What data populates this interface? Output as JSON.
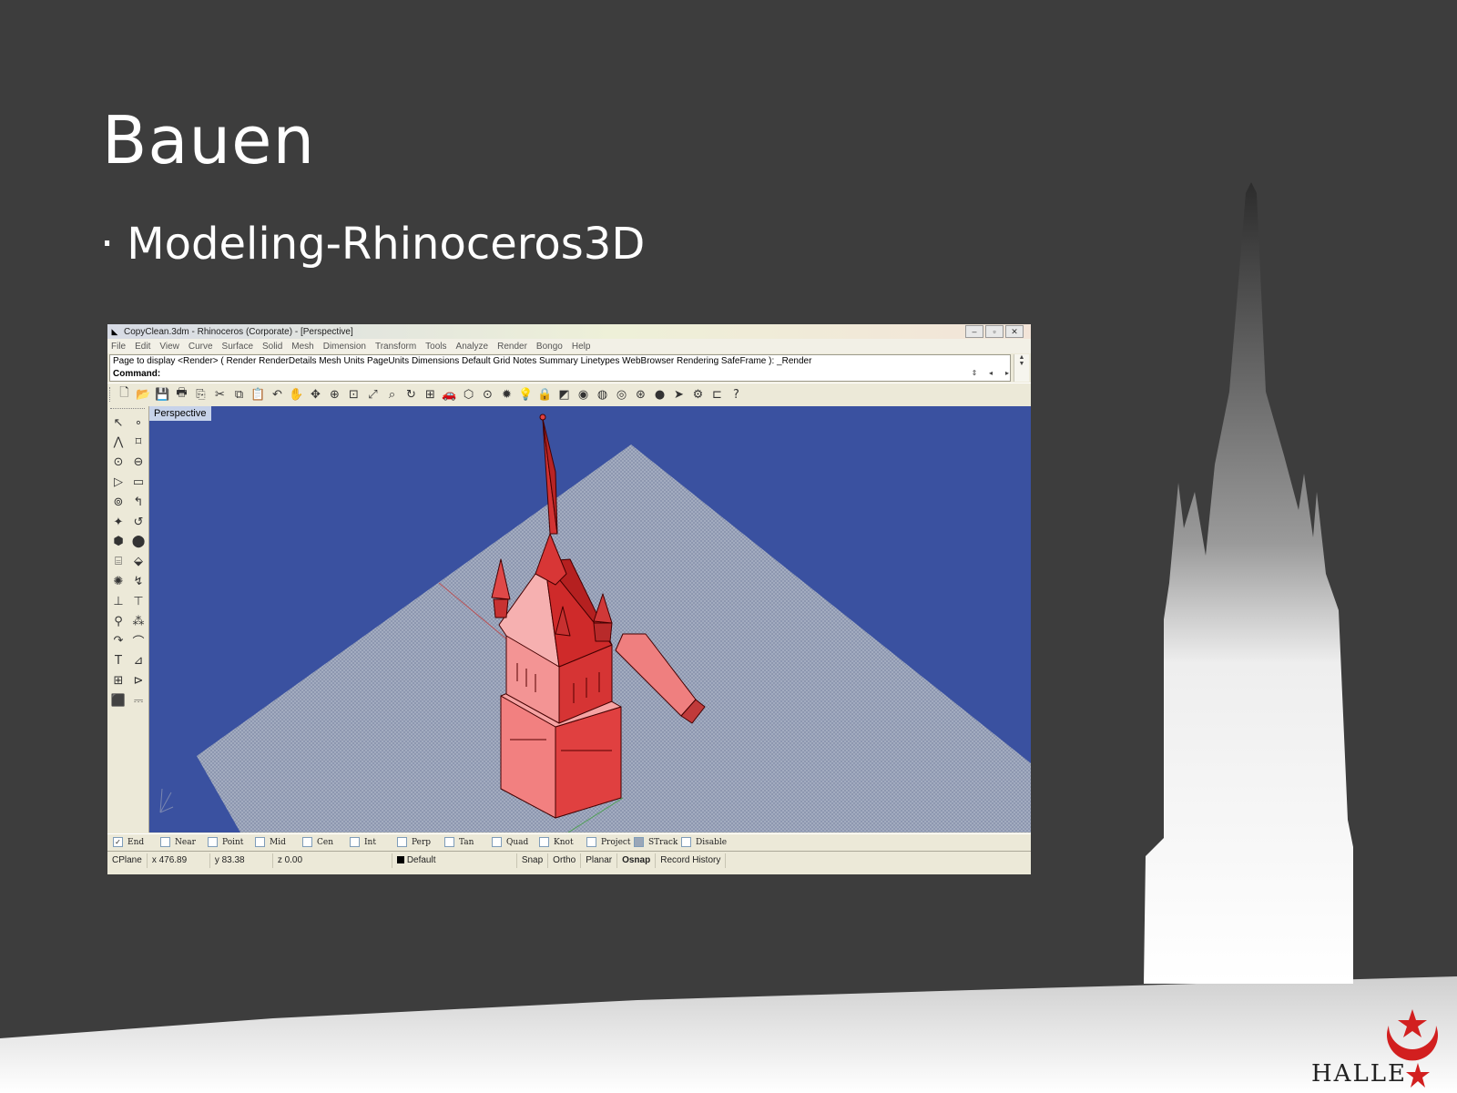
{
  "slide": {
    "title": "Bauen",
    "bullet_marker": "·",
    "bullet": "Modeling-Rhinoceros3D"
  },
  "rhino": {
    "window_title": "CopyClean.3dm - Rhinoceros (Corporate) - [Perspective]",
    "window_buttons": [
      "–",
      "▫",
      "✕"
    ],
    "menu": [
      "File",
      "Edit",
      "View",
      "Curve",
      "Surface",
      "Solid",
      "Mesh",
      "Dimension",
      "Transform",
      "Tools",
      "Analyze",
      "Render",
      "Bongo",
      "Help"
    ],
    "command_history": "Page to display <Render> ( Render  RenderDetails  Mesh  Units  PageUnits  Dimensions  Default  Grid  Notes  Summary  Linetypes  WebBrowser  Rendering  SafeFrame ): _Render",
    "command_label": "Command:",
    "toolbar_icons": [
      "new-file",
      "open-file",
      "save",
      "print",
      "import",
      "cut",
      "copy",
      "paste",
      "undo",
      "pan-hand",
      "move",
      "zoom-in",
      "zoom-window",
      "zoom-extents",
      "zoom-selected",
      "rotate-view",
      "four-viewports",
      "car-tool",
      "render-mesh",
      "point-tool",
      "snapshot-tool",
      "light-bulb",
      "lock",
      "materials",
      "color-wheel",
      "render-sphere",
      "grid-sphere",
      "render-preview",
      "shaded-sphere",
      "flag",
      "settings-gear",
      "layout-tool",
      "help"
    ],
    "viewport_label": "Perspective",
    "osnap": [
      {
        "label": "End",
        "checked": true
      },
      {
        "label": "Near",
        "checked": false
      },
      {
        "label": "Point",
        "checked": false
      },
      {
        "label": "Mid",
        "checked": false
      },
      {
        "label": "Cen",
        "checked": false
      },
      {
        "label": "Int",
        "checked": false
      },
      {
        "label": "Perp",
        "checked": false
      },
      {
        "label": "Tan",
        "checked": false
      },
      {
        "label": "Quad",
        "checked": false
      },
      {
        "label": "Knot",
        "checked": false
      },
      {
        "label": "Project",
        "checked": false
      },
      {
        "label": "STrack",
        "checked": false
      },
      {
        "label": "Disable",
        "checked": false
      }
    ],
    "status": {
      "cplane": "CPlane",
      "x": "x 476.89",
      "y": "y 83.38",
      "z": "z 0.00",
      "layer": "Default",
      "snap": "Snap",
      "ortho": "Ortho",
      "planar": "Planar",
      "osnap": "Osnap",
      "record_history": "Record History"
    }
  },
  "logo": {
    "text": "HALLE"
  },
  "colors": {
    "slide_bg": "#3d3d3d",
    "viewport_bg": "#3a51a0",
    "model_red": "#e03030"
  }
}
